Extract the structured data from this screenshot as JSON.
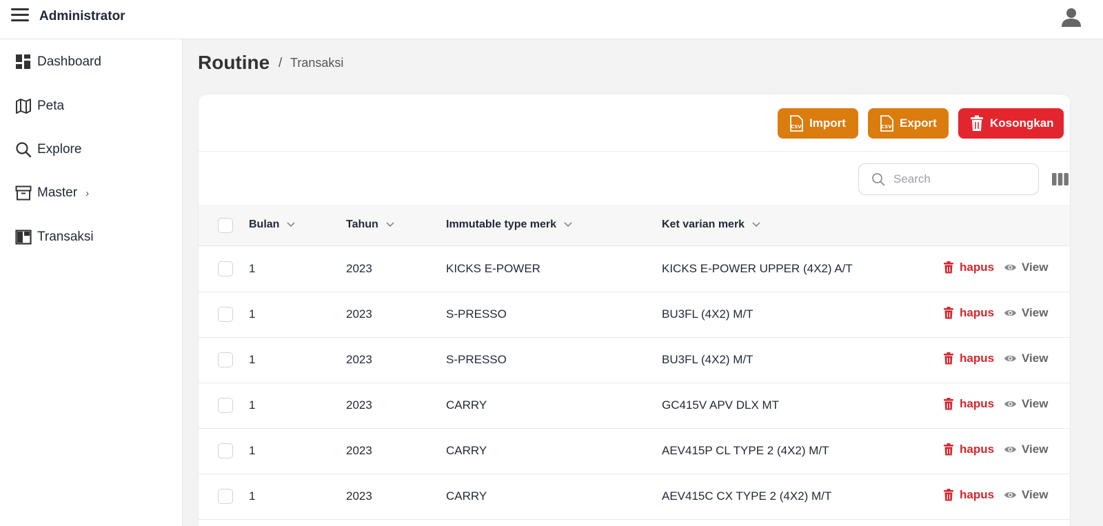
{
  "header": {
    "title": "Administrator",
    "menu_icon": "hamburger-icon",
    "user_icon": "user-icon"
  },
  "sidebar": {
    "items": [
      {
        "label": "Dashboard",
        "icon": "dashboard-icon"
      },
      {
        "label": "Peta",
        "icon": "map-icon"
      },
      {
        "label": "Explore",
        "icon": "search-icon"
      },
      {
        "label": "Master",
        "icon": "archive-icon",
        "chevron": "›"
      },
      {
        "label": "Transaksi",
        "icon": "layout-icon"
      }
    ]
  },
  "page": {
    "title": "Routine",
    "breadcrumb_sep": "/",
    "breadcrumb": "Transaksi"
  },
  "toolbar": {
    "import_label": "Import",
    "export_label": "Export",
    "clear_label": "Kosongkan"
  },
  "search": {
    "placeholder": "Search",
    "value": ""
  },
  "colors": {
    "orange": "#db7c0f",
    "red": "#e3262d",
    "delete_text": "#d4262d"
  },
  "table": {
    "columns": [
      "Bulan",
      "Tahun",
      "Immutable type merk",
      "Ket varian merk"
    ],
    "delete_label": "hapus",
    "view_label": "View",
    "rows": [
      [
        "1",
        "2023",
        "KICKS E-POWER",
        "KICKS E-POWER UPPER (4X2) A/T"
      ],
      [
        "1",
        "2023",
        "S-PRESSO",
        "BU3FL (4X2) M/T"
      ],
      [
        "1",
        "2023",
        "S-PRESSO",
        "BU3FL (4X2) M/T"
      ],
      [
        "1",
        "2023",
        "CARRY",
        "GC415V APV DLX MT"
      ],
      [
        "1",
        "2023",
        "CARRY",
        "AEV415P CL TYPE 2 (4X2) M/T"
      ],
      [
        "1",
        "2023",
        "CARRY",
        "AEV415C CX TYPE 2 (4X2) M/T"
      ]
    ]
  }
}
